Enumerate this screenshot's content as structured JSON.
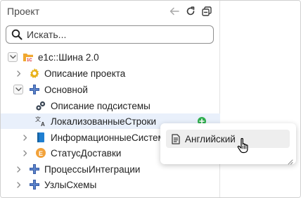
{
  "panel": {
    "title": "Проект"
  },
  "search": {
    "placeholder": "Искать..."
  },
  "tree": {
    "root": {
      "label": "e1c::Шина 2.0",
      "expanded": true
    },
    "project_description": {
      "label": "Описание проекта",
      "expanded": false
    },
    "main": {
      "label": "Основной",
      "expanded": true
    },
    "subsystem_description": {
      "label": "Описание подсистемы"
    },
    "localized_strings": {
      "label": "ЛокализованныеСтроки",
      "selected": true
    },
    "info_systems": {
      "label": "ИнформационныеСистем",
      "expanded": false
    },
    "delivery_status": {
      "label": "СтатусДоставки",
      "expanded": false
    },
    "integration_processes": {
      "label": "ПроцессыИнтеграции",
      "expanded": false
    },
    "schema_nodes": {
      "label": "УзлыСхемы",
      "expanded": false
    }
  },
  "popup": {
    "items": [
      {
        "label": "Английский",
        "icon": "language-file-icon"
      }
    ]
  },
  "colors": {
    "selection": "#e9f0fb",
    "accent_green": "#2fae4e",
    "folder_orange": "#f0a830",
    "gear_yellow": "#e8b21a",
    "grid_blue": "#3a5fa8",
    "book_blue": "#1f7fd1",
    "enum_orange": "#f2a23a"
  }
}
